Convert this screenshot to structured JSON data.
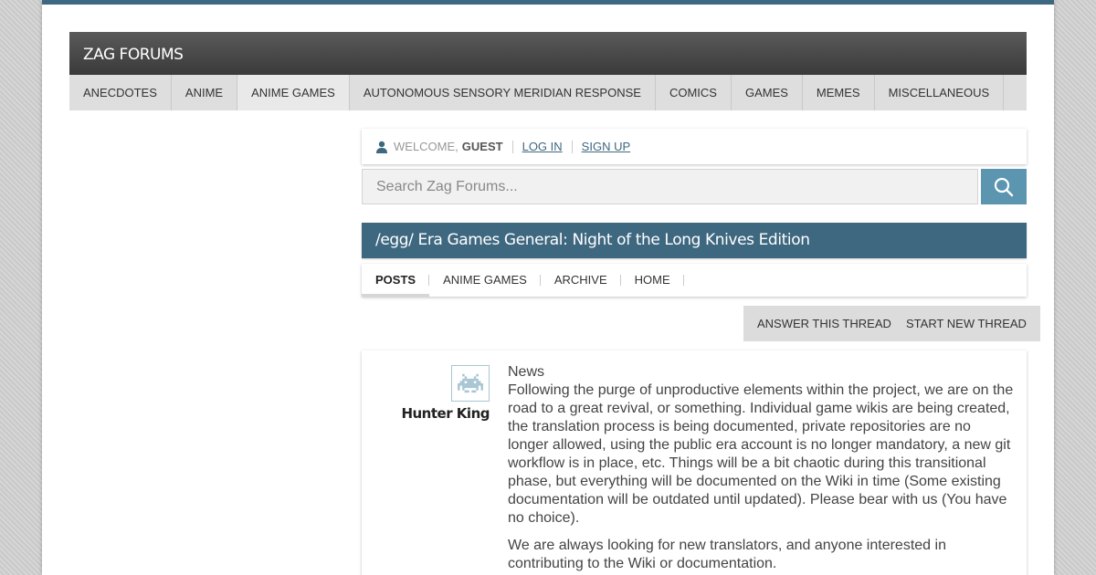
{
  "site": {
    "title": "ZAG FORUMS"
  },
  "categories": [
    {
      "label": "ANECDOTES"
    },
    {
      "label": "ANIME"
    },
    {
      "label": "ANIME GAMES"
    },
    {
      "label": "AUTONOMOUS SENSORY MERIDIAN RESPONSE"
    },
    {
      "label": "COMICS"
    },
    {
      "label": "GAMES"
    },
    {
      "label": "MEMES"
    },
    {
      "label": "MISCELLANEOUS"
    }
  ],
  "userbar": {
    "icon": "user-icon",
    "welcome": "WELCOME,",
    "user": "GUEST",
    "login": "LOG IN",
    "signup": "SIGN UP"
  },
  "search": {
    "placeholder": "Search Zag Forums...",
    "value": "",
    "icon": "search-icon"
  },
  "thread": {
    "title": "/egg/ Era Games General: Night of the Long Knives Edition",
    "tabs": [
      {
        "label": "POSTS"
      },
      {
        "label": "ANIME GAMES"
      },
      {
        "label": "ARCHIVE"
      },
      {
        "label": "HOME"
      }
    ],
    "actions": {
      "answer": "ANSWER THIS THREAD",
      "start": "START NEW THREAD"
    }
  },
  "post": {
    "author": "Hunter King",
    "avatar_icon": "space-invader-icon",
    "heading": "News",
    "paragraphs": [
      "Following the purge of unproductive elements within the project, we are on the road to a great revival, or something. Individual game wikis are being created, the translation process is being documented, private repositories are no longer allowed, using the public era account is no longer mandatory, a new git workflow is in place, etc. Things will be a bit chaotic during this transitional phase, but everything will be documented on the Wiki in time (Some existing documentation will be outdated until updated). Please bear with us (You have no choice).",
      "We are always looking for new translators, and anyone interested in contributing to the Wiki or documentation."
    ]
  },
  "colors": {
    "accent": "#3e6880",
    "search_button": "#5b95b0",
    "header_dark": "#4a4a4a",
    "nav_bg": "#dedede"
  }
}
